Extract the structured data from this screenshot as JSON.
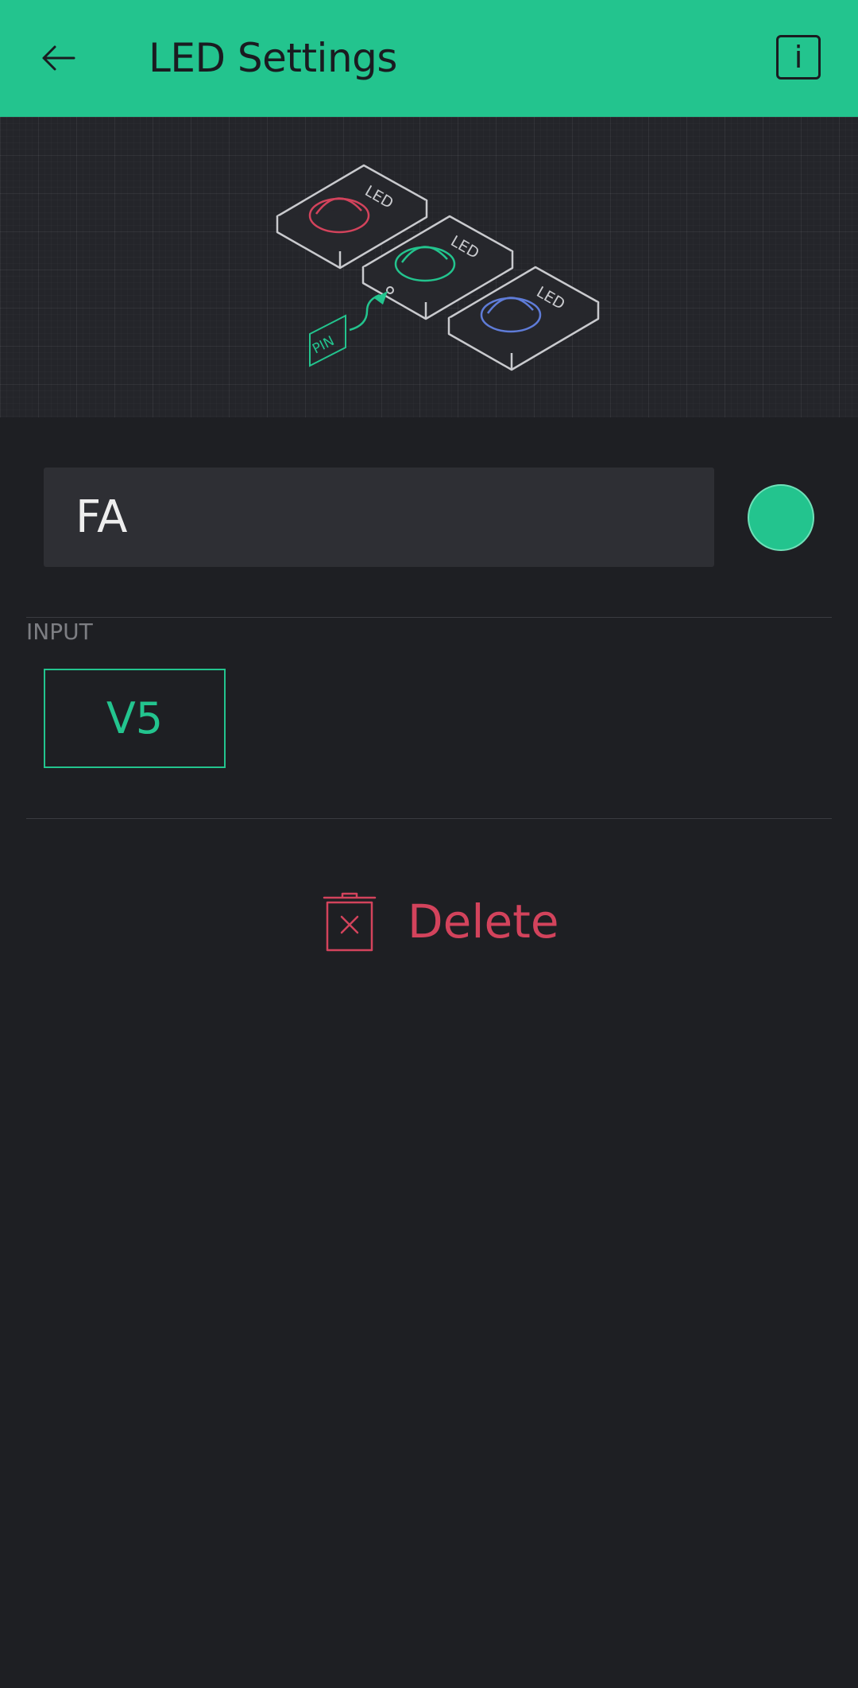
{
  "header": {
    "title": "LED Settings",
    "back_icon": "arrow-left-icon",
    "info_label": "i",
    "background_color": "#23c48e"
  },
  "illustration": {
    "led_labels": [
      "LED",
      "LED",
      "LED"
    ],
    "pin_label": "PIN",
    "led_colors": [
      "#d3435c",
      "#23c48e",
      "#5f7cd8"
    ]
  },
  "name_field": {
    "value": "FA"
  },
  "color_picker": {
    "color": "#23c48e"
  },
  "input_section": {
    "label": "INPUT",
    "pin_value": "V5"
  },
  "delete": {
    "label": "Delete",
    "icon": "trash-icon",
    "color": "#d3435c"
  }
}
